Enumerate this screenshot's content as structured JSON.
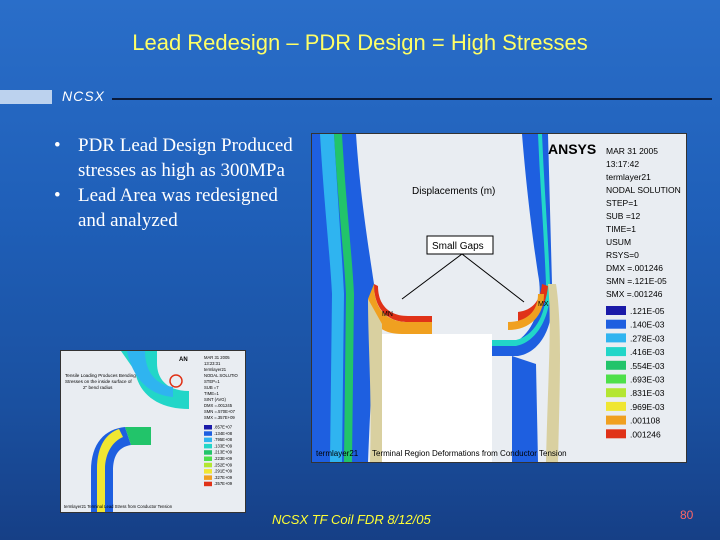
{
  "slide": {
    "title": "Lead Redesign – PDR Design = High Stresses",
    "brand": "NCSX",
    "bullets": [
      "PDR Lead Design Produced stresses as high as 300MPa",
      "Lead Area was redesigned and analyzed"
    ],
    "footer": "NCSX TF Coil FDR  8/12/05",
    "page_number": "80"
  },
  "figure_main": {
    "logo": "ANSYS",
    "info": [
      "MAR 31 2005",
      "13:17:42",
      "termlayer21",
      "NODAL SOLUTION",
      "STEP=1",
      "SUB =12",
      "TIME=1",
      "USUM",
      "RSYS=0",
      "DMX =.001246",
      "SMN =.121E-05",
      "SMX =.001246"
    ],
    "plot_label": "Displacements (m)",
    "callout": "Small Gaps",
    "legend_values": [
      ".121E-05",
      ".140E-03",
      ".278E-03",
      ".416E-03",
      ".554E-03",
      ".693E-03",
      ".831E-03",
      ".969E-03",
      ".001108",
      ".001246"
    ],
    "legend_colors": [
      "#1a1aa8",
      "#1e5fe0",
      "#2fb4f0",
      "#22d6c8",
      "#22c46a",
      "#4ee04a",
      "#b4e632",
      "#f0e632",
      "#f0a020",
      "#e03218"
    ],
    "caption_left": "termlayer21",
    "caption": "Terminal Region Deformations from Conductor Tension",
    "node_labels": [
      "MN",
      "MX"
    ]
  },
  "figure_small": {
    "logo": "AN",
    "info": [
      "MAR 31 2005",
      "13:23:31",
      "termlayer21",
      "NODAL SOLUTIO",
      "STEP=1",
      "SUB =7",
      "TIME=1",
      "SINT (AVG)",
      "DMX =.001245",
      "SMN =.570E+07",
      "SMX =.357E+09"
    ],
    "annotation": [
      "Tensile Loading Produces Bending",
      "Stresses on the inside surface of",
      "2\" bend radius"
    ],
    "legend_values": [
      ".857E+07",
      ".134E+08",
      ".795E+08",
      ".133E+09",
      ".213E+09",
      ".223E+09",
      ".252E+09",
      ".291E+09",
      ".327E+09",
      ".357E+09"
    ],
    "legend_colors": [
      "#1a1aa8",
      "#1e5fe0",
      "#2fb4f0",
      "#22d6c8",
      "#22c46a",
      "#4ee04a",
      "#b4e632",
      "#f0e632",
      "#f0a020",
      "#e03218"
    ],
    "caption": "termlayer21  Terminal Lead Stress from Conductor Tension"
  }
}
